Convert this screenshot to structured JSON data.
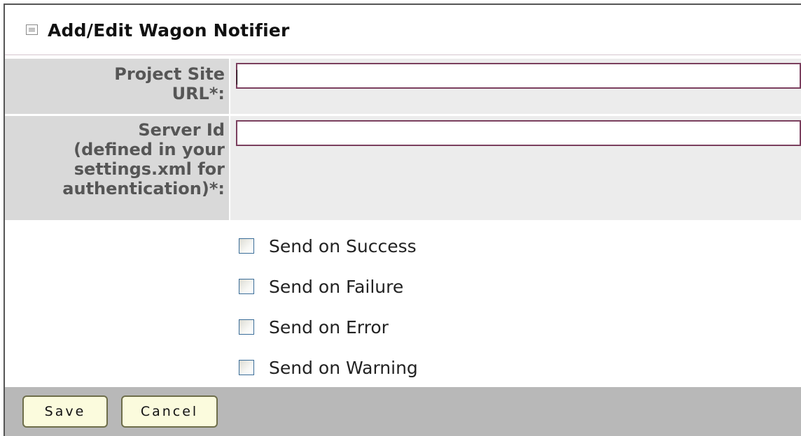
{
  "form": {
    "title": "Add/Edit Wagon Notifier",
    "fields": [
      {
        "label_lines": [
          "Project Site",
          "URL*:"
        ],
        "value": ""
      },
      {
        "label_lines": [
          "Server Id",
          "(defined in your",
          "settings.xml for",
          "authentication)*:"
        ],
        "value": ""
      }
    ],
    "checkboxes": [
      {
        "label": "Send on Success",
        "checked": false
      },
      {
        "label": "Send on Failure",
        "checked": false
      },
      {
        "label": "Send on Error",
        "checked": false
      },
      {
        "label": "Send on Warning",
        "checked": false
      }
    ],
    "buttons": {
      "save": "Save",
      "cancel": "Cancel"
    }
  },
  "colors": {
    "label_background": "#d9d9d9",
    "value_background": "#ececec",
    "footer_background": "#b8b8b8",
    "input_border": "#7b3f5e",
    "button_background": "#fbfbdd"
  },
  "icons": {
    "collapse": "collapse-toggle-icon",
    "checkbox": "checkbox-icon"
  }
}
